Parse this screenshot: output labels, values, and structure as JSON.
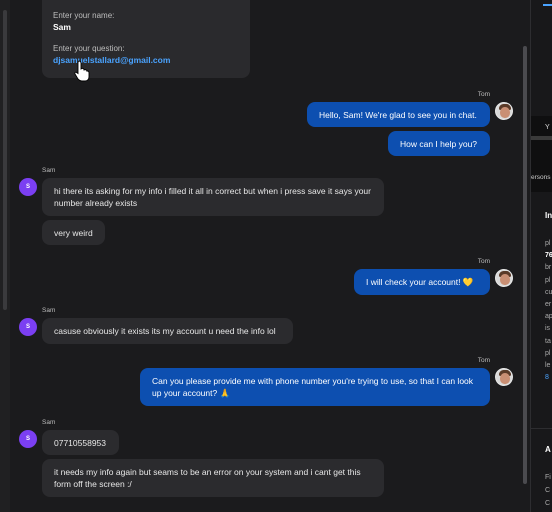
{
  "form_card": {
    "name_label": "Enter your name:",
    "name_value": "Sam",
    "question_label": "Enter your question:",
    "question_value": "djsamuelstallard@gmail.com"
  },
  "messages": [
    {
      "sender": "Tom",
      "text": "Hello, Sam! We're glad to see you in chat."
    },
    {
      "sender": "",
      "text": "How can I help you?"
    },
    {
      "sender": "Sam",
      "text": "hi there its asking for my info i filled it all in correct but when i press save it says your number already exists"
    },
    {
      "sender": "",
      "text": "very weird"
    },
    {
      "sender": "Tom",
      "text": "I will check your account! 💛"
    },
    {
      "sender": "Sam",
      "text": "casuse obviously it exists its my account u need the info lol"
    },
    {
      "sender": "Tom",
      "text": "Can you please provide me with phone number you're trying to use, so that I can look up your account? 🙏"
    },
    {
      "sender": "Sam",
      "text": "07710558953"
    },
    {
      "sender": "",
      "text": "it needs my info again but seams to be an error on your system and i cant get this form off the screen :/"
    }
  ],
  "avatars": {
    "sam_initial": "S"
  },
  "side_panel": {
    "fragments": [
      "Y",
      "ersons",
      "In",
      "pl",
      "76",
      "br",
      "pl",
      "cu",
      "er",
      "ap",
      "is",
      "ta",
      "pl",
      "le",
      "8",
      "A",
      "Fi",
      "C",
      "C"
    ]
  },
  "colors": {
    "outgoing": "#0d4fb0",
    "incoming": "#2b2b2e",
    "background": "#1b1b1d",
    "link": "#4aa3ff",
    "avatar_sam": "#7b3ff2"
  }
}
